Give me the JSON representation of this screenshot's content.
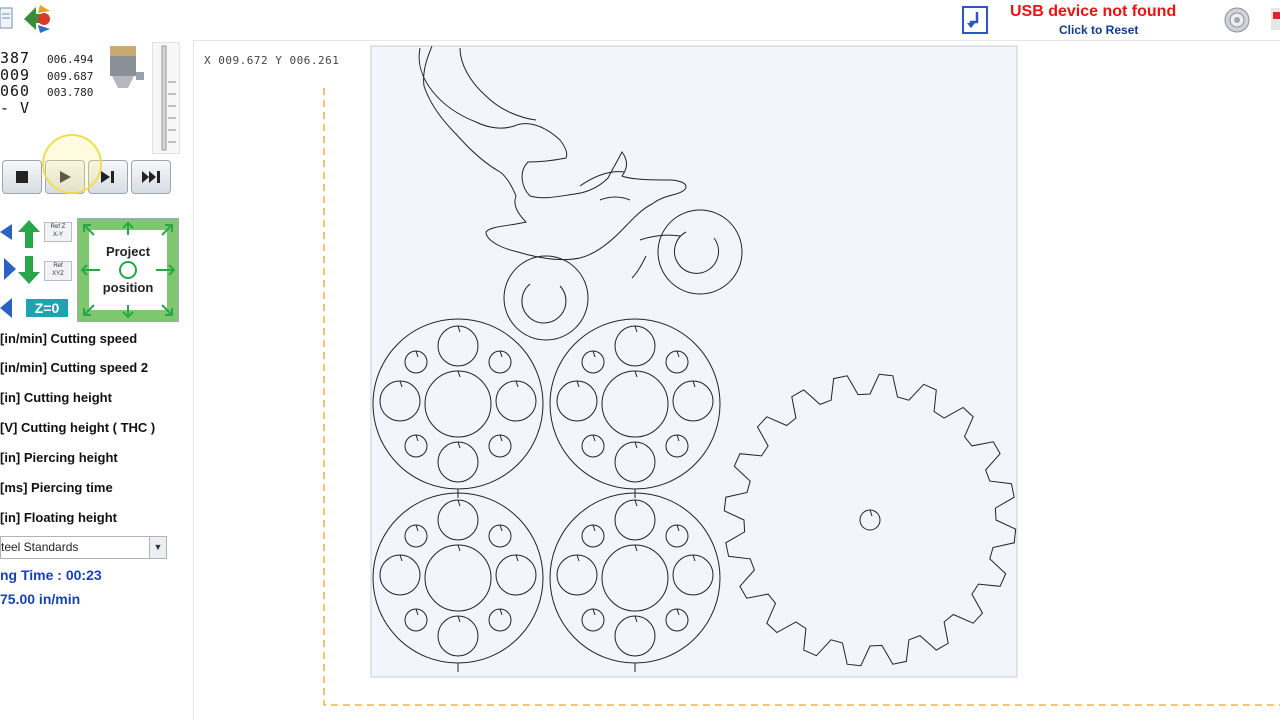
{
  "toolbar": {
    "usb_status": "USB device not found",
    "usb_action": "Click to Reset"
  },
  "position": {
    "col_a": [
      "387",
      "009",
      "060",
      "- V"
    ],
    "col_b": [
      "006.494",
      "009.687",
      "003.780"
    ]
  },
  "controls": {
    "buttons": [
      "stop",
      "play",
      "step",
      "fast-forward"
    ],
    "ref_z": "Ref Z",
    "ref_xy": "X-Y",
    "ref": "Ref",
    "ref_xyz": "XYZ",
    "z_zero": "Z=0",
    "project_line1": "Project",
    "project_line2": "position"
  },
  "params": [
    "[in/min] Cutting speed",
    "[in/min] Cutting speed 2",
    "[in] Cutting height",
    "[V] Cutting height ( THC )",
    "[in] Piercing height",
    "[ms] Piercing time",
    "[in] Floating height"
  ],
  "material": {
    "selected": "teel Standards"
  },
  "status": {
    "time": "ng Time : 00:23",
    "speed": "75.00 in/min"
  },
  "canvas": {
    "readout": "X 009.672   Y 006.261"
  },
  "colors": {
    "usb_red": "#ee1111",
    "usb_blue": "#123b84",
    "status_blue": "#1642b4",
    "jog_green": "#2aa64a",
    "zero_teal": "#1ea3b0",
    "table_border": "#f0a020",
    "sheet_bg": "#f3f5fd"
  }
}
